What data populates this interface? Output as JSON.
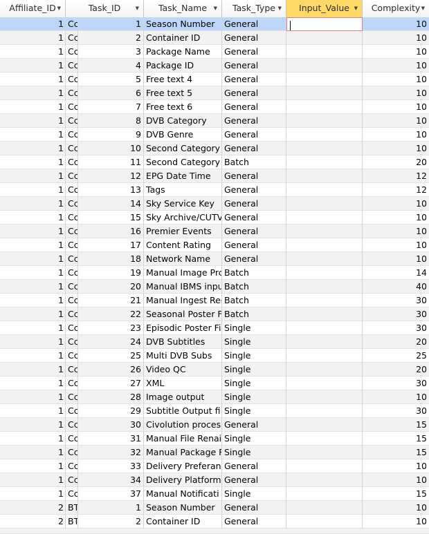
{
  "headers": [
    "Affiliate_ID",
    "Task_ID",
    "Task_Name",
    "Task_Type",
    "Input_Value",
    "Complexity"
  ],
  "sort_icon": "dropdown-arrow-icon",
  "rows": [
    {
      "aff": "1",
      "aff2": "Cc",
      "id": "1",
      "name": "Season Number",
      "type": "General",
      "input": "",
      "cx": "10"
    },
    {
      "aff": "1",
      "aff2": "Cc",
      "id": "2",
      "name": "Container ID",
      "type": "General",
      "input": "",
      "cx": "10"
    },
    {
      "aff": "1",
      "aff2": "Cc",
      "id": "3",
      "name": "Package Name",
      "type": "General",
      "input": "",
      "cx": "10"
    },
    {
      "aff": "1",
      "aff2": "Cc",
      "id": "4",
      "name": "Package ID",
      "type": "General",
      "input": "",
      "cx": "10"
    },
    {
      "aff": "1",
      "aff2": "Cc",
      "id": "5",
      "name": "Free text 4",
      "type": "General",
      "input": "",
      "cx": "10"
    },
    {
      "aff": "1",
      "aff2": "Cc",
      "id": "6",
      "name": "Free text 5",
      "type": "General",
      "input": "",
      "cx": "10"
    },
    {
      "aff": "1",
      "aff2": "Cc",
      "id": "7",
      "name": "Free text 6",
      "type": "General",
      "input": "",
      "cx": "10"
    },
    {
      "aff": "1",
      "aff2": "Cc",
      "id": "8",
      "name": "DVB Category",
      "type": "General",
      "input": "",
      "cx": "10"
    },
    {
      "aff": "1",
      "aff2": "Cc",
      "id": "9",
      "name": "DVB Genre",
      "type": "General",
      "input": "",
      "cx": "10"
    },
    {
      "aff": "1",
      "aff2": "Cc",
      "id": "10",
      "name": "Second Category",
      "type": "General",
      "input": "",
      "cx": "10"
    },
    {
      "aff": "1",
      "aff2": "Cc",
      "id": "11",
      "name": "Second Category (",
      "type": "Batch",
      "input": "",
      "cx": "20"
    },
    {
      "aff": "1",
      "aff2": "Cc",
      "id": "12",
      "name": "EPG Date Time",
      "type": "General",
      "input": "",
      "cx": "12"
    },
    {
      "aff": "1",
      "aff2": "Cc",
      "id": "13",
      "name": "Tags",
      "type": "General",
      "input": "",
      "cx": "12"
    },
    {
      "aff": "1",
      "aff2": "Cc",
      "id": "14",
      "name": "Sky Service Key",
      "type": "General",
      "input": "",
      "cx": "10"
    },
    {
      "aff": "1",
      "aff2": "Cc",
      "id": "15",
      "name": "Sky Archive/CUTV",
      "type": "General",
      "input": "",
      "cx": "10"
    },
    {
      "aff": "1",
      "aff2": "Cc",
      "id": "16",
      "name": "Premier Events",
      "type": "General",
      "input": "",
      "cx": "10"
    },
    {
      "aff": "1",
      "aff2": "Cc",
      "id": "17",
      "name": "Content Rating",
      "type": "General",
      "input": "",
      "cx": "10"
    },
    {
      "aff": "1",
      "aff2": "Cc",
      "id": "18",
      "name": "Network Name",
      "type": "General",
      "input": "",
      "cx": "10"
    },
    {
      "aff": "1",
      "aff2": "Cc",
      "id": "19",
      "name": "Manual Image Prc",
      "type": "Batch",
      "input": "",
      "cx": "14"
    },
    {
      "aff": "1",
      "aff2": "Cc",
      "id": "20",
      "name": "Manual IBMS inpu",
      "type": "Batch",
      "input": "",
      "cx": "40"
    },
    {
      "aff": "1",
      "aff2": "Cc",
      "id": "21",
      "name": "Manual Ingest Rec",
      "type": "Batch",
      "input": "",
      "cx": "30"
    },
    {
      "aff": "1",
      "aff2": "Cc",
      "id": "22",
      "name": "Seasonal Poster F",
      "type": "Batch",
      "input": "",
      "cx": "30"
    },
    {
      "aff": "1",
      "aff2": "Cc",
      "id": "23",
      "name": "Episodic Poster Fi",
      "type": "Single",
      "input": "",
      "cx": "30"
    },
    {
      "aff": "1",
      "aff2": "Cc",
      "id": "24",
      "name": "DVB Subtitles",
      "type": "Single",
      "input": "",
      "cx": "20"
    },
    {
      "aff": "1",
      "aff2": "Cc",
      "id": "25",
      "name": "Multi DVB Subs",
      "type": "Single",
      "input": "",
      "cx": "25"
    },
    {
      "aff": "1",
      "aff2": "Cc",
      "id": "26",
      "name": "Video QC",
      "type": "Single",
      "input": "",
      "cx": "20"
    },
    {
      "aff": "1",
      "aff2": "Cc",
      "id": "27",
      "name": "XML",
      "type": "Single",
      "input": "",
      "cx": "30"
    },
    {
      "aff": "1",
      "aff2": "Cc",
      "id": "28",
      "name": "Image output",
      "type": "Single",
      "input": "",
      "cx": "10"
    },
    {
      "aff": "1",
      "aff2": "Cc",
      "id": "29",
      "name": "Subtitle Output fi",
      "type": "Single",
      "input": "",
      "cx": "30"
    },
    {
      "aff": "1",
      "aff2": "Cc",
      "id": "30",
      "name": "Civolution proces",
      "type": "General",
      "input": "",
      "cx": "15"
    },
    {
      "aff": "1",
      "aff2": "Cc",
      "id": "31",
      "name": "Manual File Renai",
      "type": "Single",
      "input": "",
      "cx": "15"
    },
    {
      "aff": "1",
      "aff2": "Cc",
      "id": "32",
      "name": "Manual Package R",
      "type": "Single",
      "input": "",
      "cx": "15"
    },
    {
      "aff": "1",
      "aff2": "Cc",
      "id": "33",
      "name": "Delivery Preferan",
      "type": "General",
      "input": "",
      "cx": "10"
    },
    {
      "aff": "1",
      "aff2": "Cc",
      "id": "34",
      "name": "Delivery Platform",
      "type": "General",
      "input": "",
      "cx": "10"
    },
    {
      "aff": "1",
      "aff2": "Cc",
      "id": "37",
      "name": "Manual Notificati",
      "type": "Single",
      "input": "",
      "cx": "15"
    },
    {
      "aff": "2",
      "aff2": "BT",
      "id": "1",
      "name": "Season Number",
      "type": "General",
      "input": "",
      "cx": "10"
    },
    {
      "aff": "2",
      "aff2": "BT",
      "id": "2",
      "name": "Container ID",
      "type": "General",
      "input": "",
      "cx": "10"
    }
  ]
}
